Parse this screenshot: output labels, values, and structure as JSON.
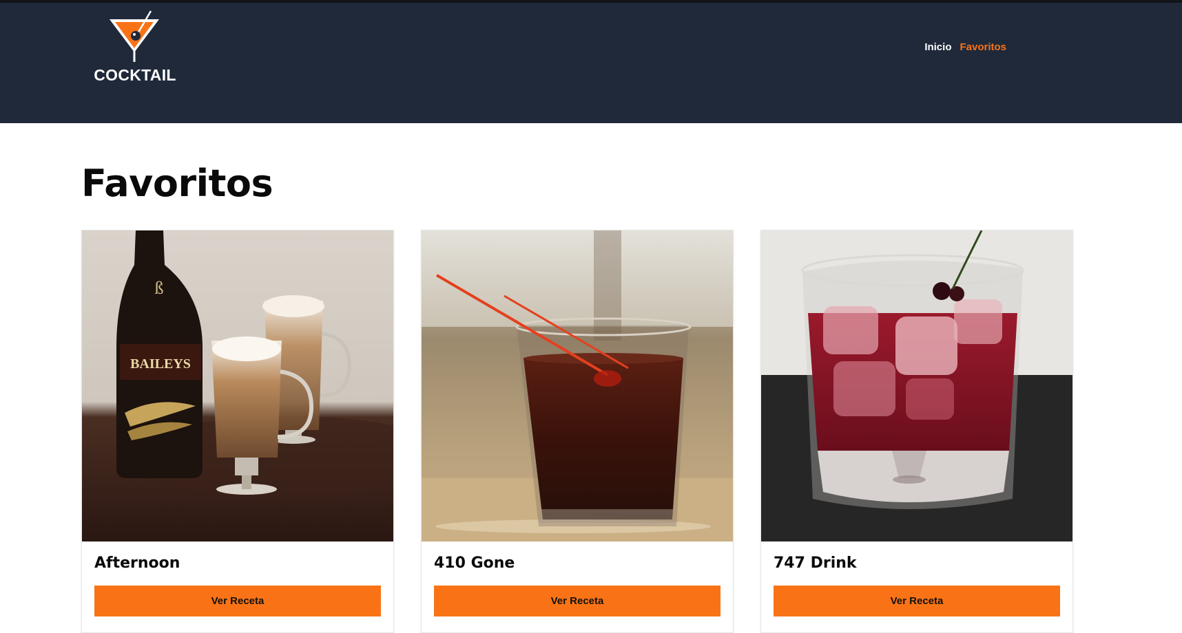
{
  "header": {
    "logo_text": "COCKTAIL",
    "nav": {
      "inicio": "Inicio",
      "favoritos": "Favoritos"
    },
    "colors": {
      "background": "#1f293a",
      "accent": "#f97316",
      "text": "#ffffff"
    }
  },
  "main": {
    "title": "Favoritos",
    "cards": [
      {
        "name": "Afternoon",
        "button_label": "Ver Receta",
        "image": "baileys-caramel-coffee-drinks-photo"
      },
      {
        "name": "410 Gone",
        "button_label": "Ver Receta",
        "image": "dark-cola-drink-glass-with-red-stir-stick-photo"
      },
      {
        "name": "747 Drink",
        "button_label": "Ver Receta",
        "image": "red-drink-on-ice-with-cherry-photo"
      }
    ]
  }
}
